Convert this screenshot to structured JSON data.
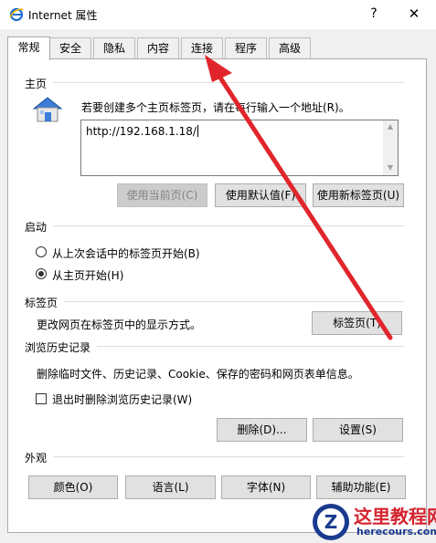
{
  "window": {
    "title": "Internet 属性",
    "help_glyph": "?",
    "close_glyph": "✕"
  },
  "tabs": [
    "常规",
    "安全",
    "隐私",
    "内容",
    "连接",
    "程序",
    "高级"
  ],
  "homepage": {
    "group_label": "主页",
    "description": "若要创建多个主页标签页，请在每行输入一个地址(R)。",
    "url_value": "http://192.168.1.18/",
    "buttons": [
      "使用当前页(C)",
      "使用默认值(F)",
      "使用新标签页(U)"
    ]
  },
  "startup": {
    "group_label": "启动",
    "options": [
      {
        "label": "从上次会话中的标签页开始(B)",
        "selected": false
      },
      {
        "label": "从主页开始(H)",
        "selected": true
      }
    ]
  },
  "tabs_section": {
    "group_label": "标签页",
    "description": "更改网页在标签页中的显示方式。",
    "button": "标签页(T)"
  },
  "history": {
    "group_label": "浏览历史记录",
    "description": "删除临时文件、历史记录、Cookie、保存的密码和网页表单信息。",
    "checkbox_label": "退出时删除浏览历史记录(W)",
    "checkbox_checked": false,
    "delete_button": "删除(D)...",
    "settings_button": "设置(S)"
  },
  "appearance": {
    "group_label": "外观",
    "buttons": [
      "颜色(O)",
      "语言(L)",
      "字体(N)",
      "辅助功能(E)"
    ]
  },
  "annotation": {
    "arrow_color": "#e0262c"
  },
  "watermark": {
    "logo_letter": "Z",
    "title": "这里教程网",
    "url": "herecours.com"
  }
}
